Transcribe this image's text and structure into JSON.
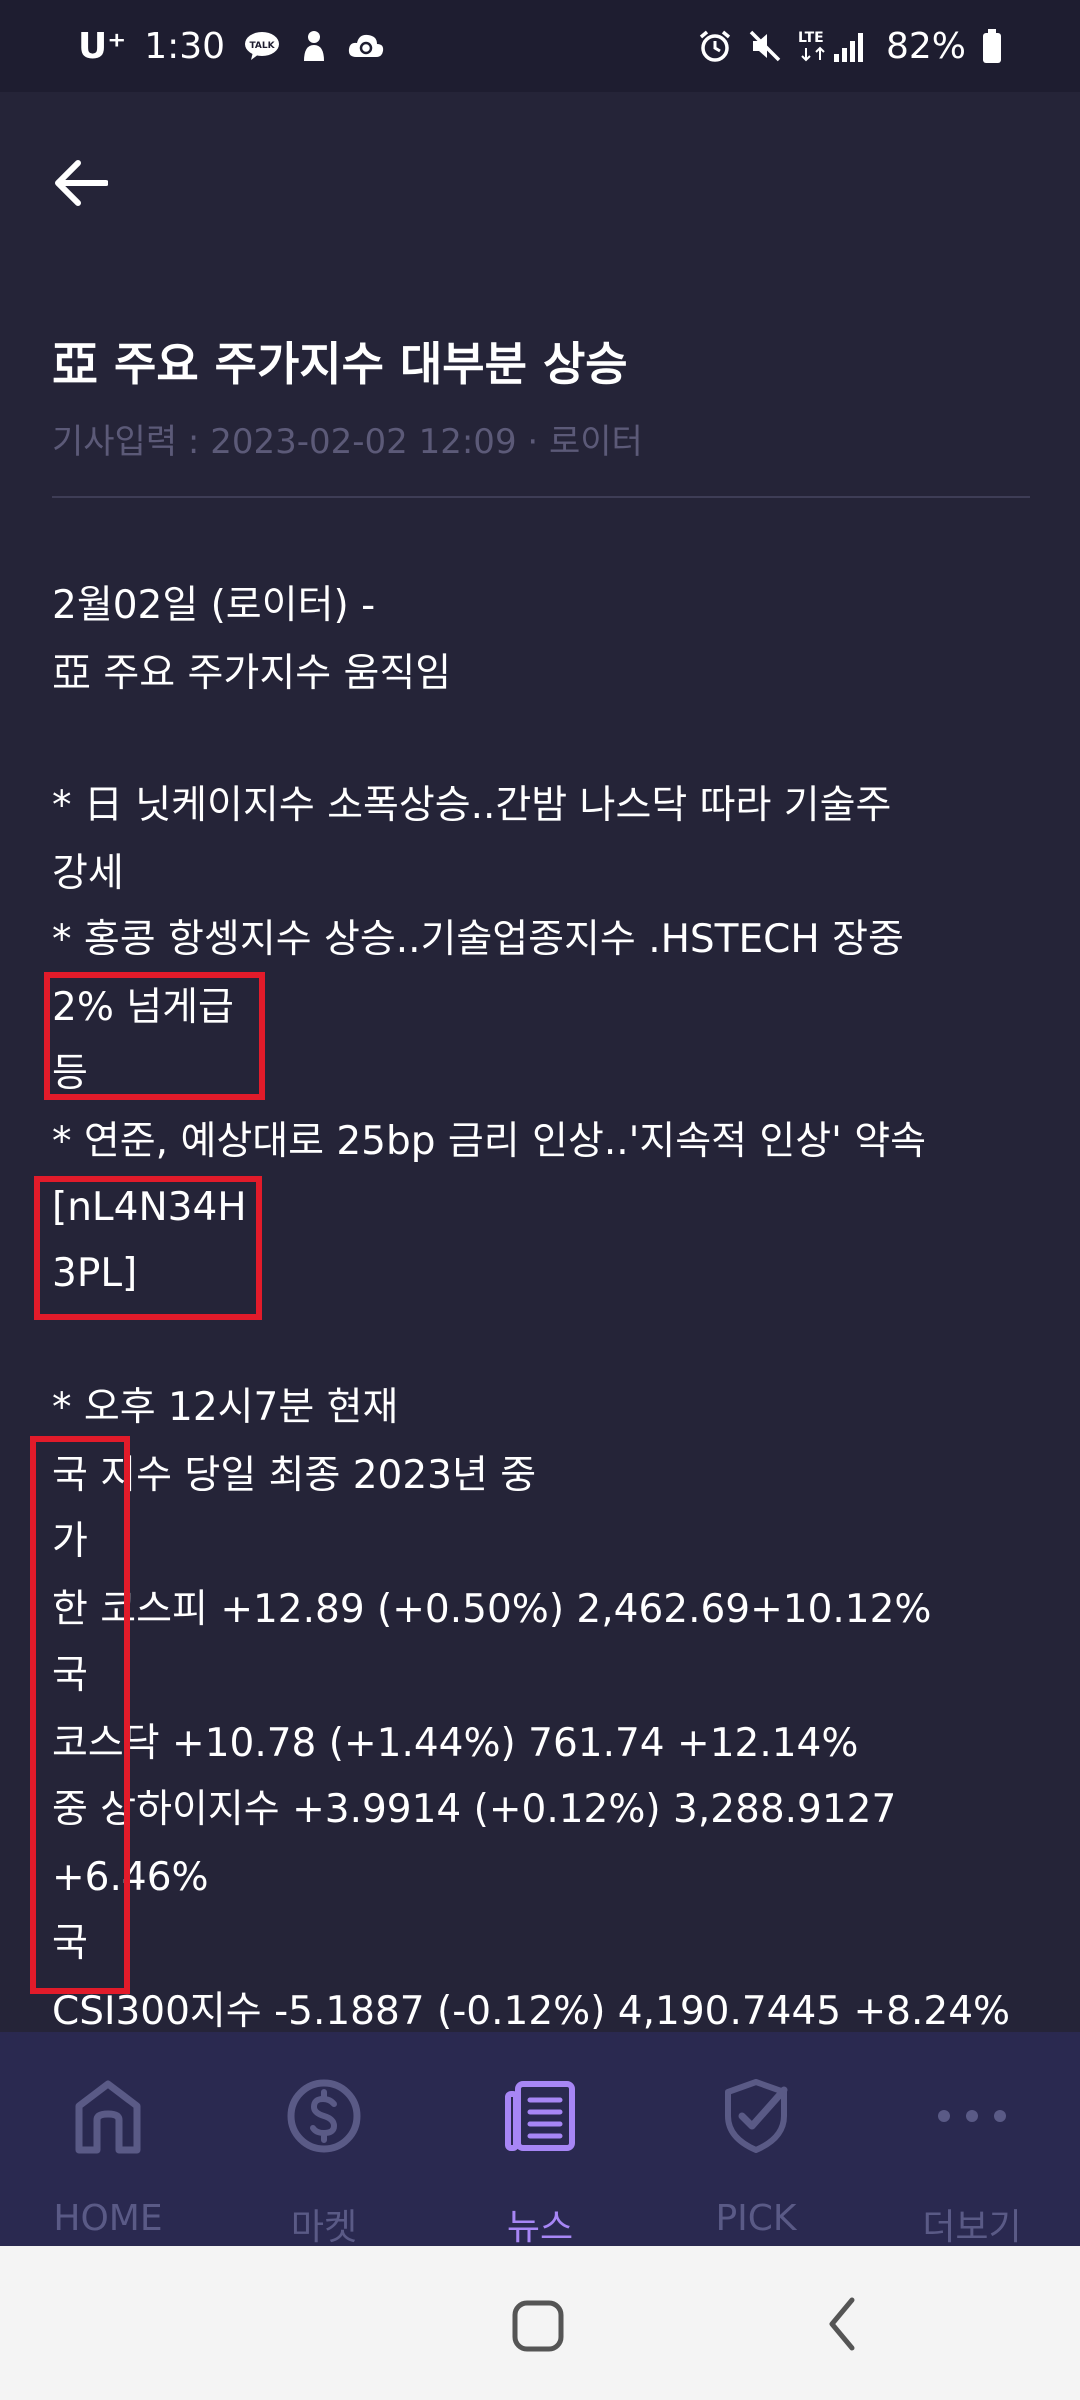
{
  "status_bar": {
    "carrier": "U⁺",
    "time": "1:30",
    "network": "LTE",
    "battery": "82%"
  },
  "article": {
    "title": "亞 주요 주가지수 대부분 상승",
    "meta": "기사입력 : 2023-02-02 12:09 · 로이터",
    "lines": [
      "2월02일 (로이터) -",
      "亞 주요 주가지수 움직임",
      "* 日 닛케이지수 소폭상승..간밤 나스닥 따라 기술주",
      "강세",
      "* 홍콩 항셍지수 상승..기술업종지수 .HSTECH 장중",
      "2% 넘게급",
      "등",
      "* 연준, 예상대로 25bp 금리 인상..'지속적 인상' 약속",
      "[nL4N34H",
      "3PL]",
      "* 오후 12시7분 현재",
      "국 지수 당일 최종 2023년 중",
      "가",
      "한 코스피 +12.89 (+0.50%) 2,462.69+10.12%",
      "국",
      "코스닥 +10.78 (+1.44%) 761.74 +12.14%",
      "중 상하이지수 +3.9914 (+0.12%) 3,288.9127",
      "+6.46%",
      "국",
      "CSI300지수 -5.1887 (-0.12%) 4,190.7445 +8.24%"
    ]
  },
  "bottom_nav": {
    "items": [
      {
        "label": "HOME",
        "icon": "home-icon"
      },
      {
        "label": "마켓",
        "icon": "dollar-icon"
      },
      {
        "label": "뉴스",
        "icon": "news-icon",
        "active": true
      },
      {
        "label": "PICK",
        "icon": "pick-icon"
      },
      {
        "label": "더보기",
        "icon": "more-icon"
      }
    ]
  },
  "colors": {
    "background": "#252438",
    "nav_background": "#2a2950",
    "accent": "#a786f5",
    "highlight_box": "#e21b2a"
  }
}
